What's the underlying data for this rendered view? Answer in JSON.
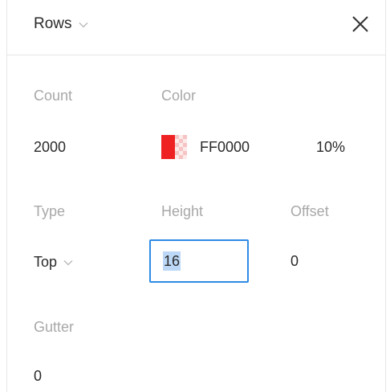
{
  "header": {
    "title": "Rows"
  },
  "count": {
    "label": "Count",
    "value": "2000"
  },
  "color": {
    "label": "Color",
    "hex": "FF0000",
    "opacity": "10%",
    "swatch_color": "#ee2222"
  },
  "type": {
    "label": "Type",
    "value": "Top"
  },
  "height": {
    "label": "Height",
    "value": "16"
  },
  "offset": {
    "label": "Offset",
    "value": "0"
  },
  "gutter": {
    "label": "Gutter",
    "value": "0"
  },
  "colors": {
    "focus_border": "#2f8be6",
    "selection": "#bcd8f6",
    "label_gray": "#a8a8a8",
    "text": "#2a2a2a"
  }
}
